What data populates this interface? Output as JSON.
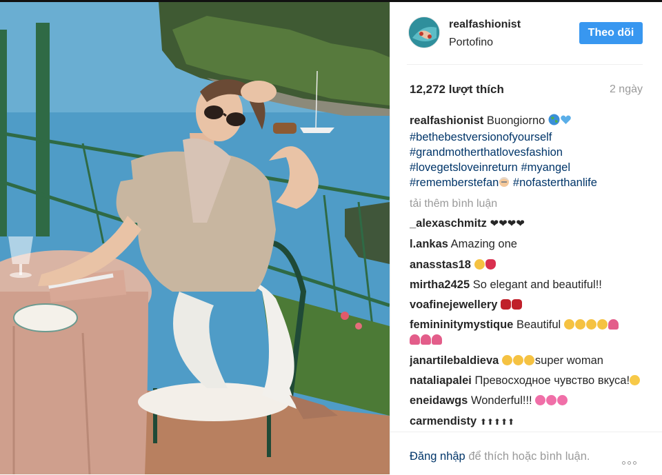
{
  "post": {
    "username": "realfashionist",
    "location": "Portofino",
    "follow_label": "Theo dõi",
    "likes": "12,272 lượt thích",
    "time": "2 ngày"
  },
  "caption": {
    "username": "realfashionist",
    "text": "Buongiorno",
    "hashtags": {
      "h1": "#bethebestversionofyourself",
      "h2": "#grandmotherthatlovesfashion",
      "h3": "#lovegetsloveinreturn",
      "h4": "#myangel",
      "h5": "#rememberstefan",
      "h6": "#nofasterthanlife"
    }
  },
  "load_more": "tải thêm bình luận",
  "comments": [
    {
      "user": "_alexaschmitz",
      "text": ""
    },
    {
      "user": "l.ankas",
      "text": "Amazing one"
    },
    {
      "user": "anasstas18",
      "text": ""
    },
    {
      "user": "mirtha2425",
      "text": "So elegant and beautiful!!"
    },
    {
      "user": "voafinejewellery",
      "text": ""
    },
    {
      "user": "femininitymystique",
      "text": "Beautiful"
    },
    {
      "user": "janartilebaldieva",
      "text": "super woman"
    },
    {
      "user": "nataliapalei",
      "text": "Превосходное чувство вкуса!"
    },
    {
      "user": "eneidawgs",
      "text": "Wonderful!!!"
    },
    {
      "user": "carmendisty",
      "text": ""
    }
  ],
  "footer": {
    "login": "Đăng nhập",
    "rest": " để thích hoặc bình luận."
  },
  "icons": {
    "globe": "globe-emoji",
    "heart": "heart-emoji",
    "more": "more-options-icon"
  },
  "colors": {
    "accent": "#3897f0",
    "link": "#003569",
    "muted": "#999999"
  }
}
